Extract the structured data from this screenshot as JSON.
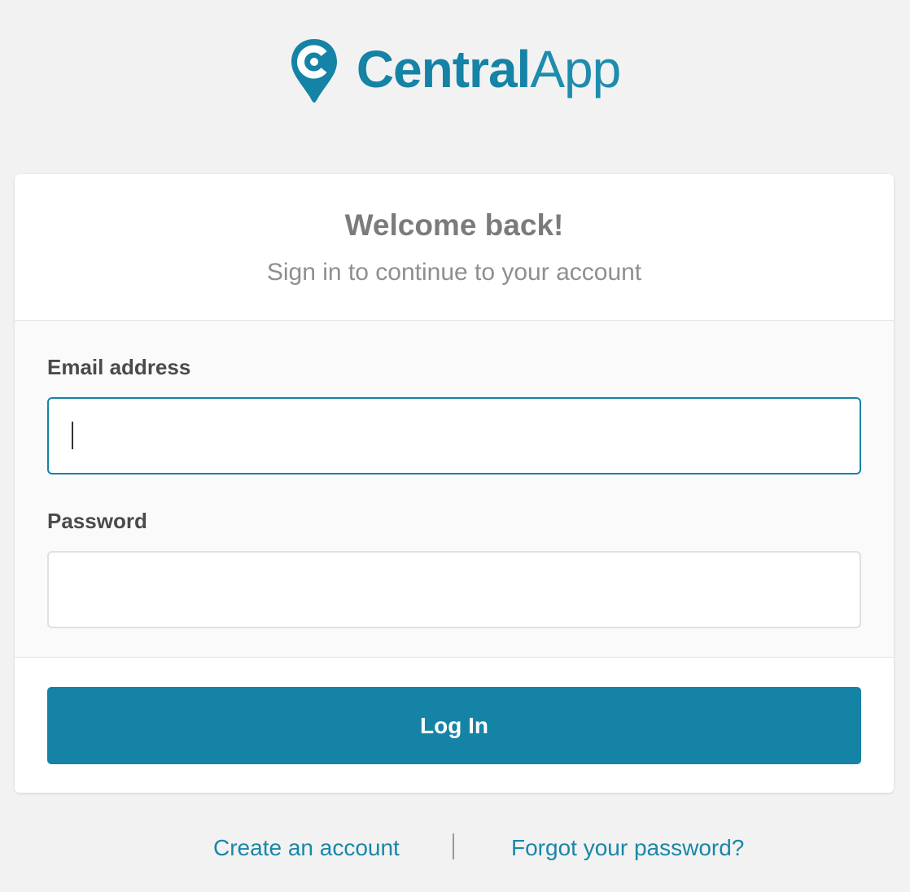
{
  "brand": {
    "name_bold": "Central",
    "name_light": "App",
    "icon": "location-pin-c-icon",
    "color": "#1583a5"
  },
  "header": {
    "title": "Welcome back!",
    "subtitle": "Sign in to continue to your account"
  },
  "form": {
    "email": {
      "label": "Email address",
      "value": "",
      "placeholder": ""
    },
    "password": {
      "label": "Password",
      "value": "",
      "placeholder": ""
    },
    "submit_label": "Log In"
  },
  "footer_links": {
    "create_account": "Create an account",
    "forgot_password": "Forgot your password?"
  }
}
